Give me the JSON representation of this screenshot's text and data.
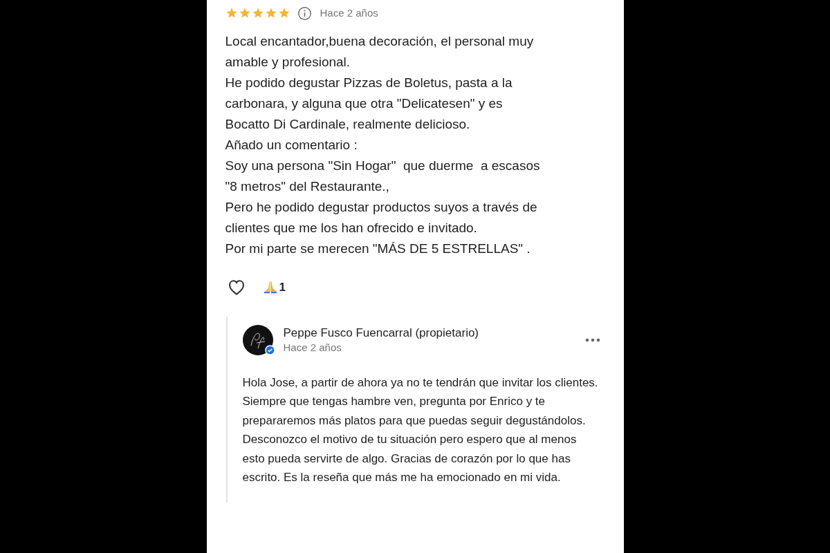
{
  "review": {
    "stars": 5,
    "time": "Hace 2 años",
    "lines": [
      "Local encantador,buena decoración, el personal muy",
      "amable y profesional.",
      "He podido degustar Pizzas de Boletus, pasta a la",
      "carbonara, y alguna que otra \"Delicatesen\" y es",
      "Bocatto Di Cardinale, realmente delicioso.",
      "Añado un comentario :",
      "Soy una persona \"Sin Hogar\"  que duerme  a escasos",
      "\"8 metros\" del Restaurante.,",
      "Pero he podido degustar productos suyos a través de",
      "clientes que me los han ofrecido e invitado.",
      "Por mi parte se merecen \"MÁS DE 5 ESTRELLAS\" ."
    ],
    "liked": false,
    "reaction_count": "1"
  },
  "owner_reply": {
    "name": "Peppe Fusco Fuencarral (propietario)",
    "time": "Hace 2 años",
    "verified": true,
    "text": "Hola Jose, a partir de ahora ya no te tendrán que invitar los clientes. Siempre que tengas hambre ven, pregunta por Enrico y te prepararemos más platos para que puedas seguir degustándolos. Desconozco el motivo de tu situación pero espero que al menos esto pueda servirte de algo. Gracias de corazón por lo que has escrito. Es la reseña que más me ha emocionado en mi vida."
  }
}
